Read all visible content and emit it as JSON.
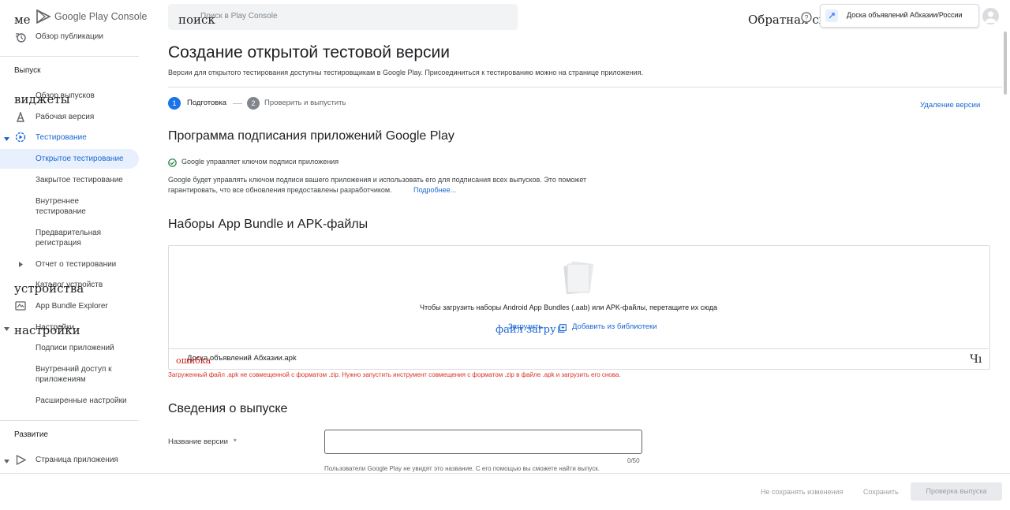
{
  "header": {
    "logo_text": "Google Play Console",
    "search_placeholder": "Поиск в Play Console",
    "search_overlay": "поиск",
    "feedback_overlay": "Обратная связь",
    "account_name": "Доска объявлений Абхазии/России",
    "menu_overlay": "ме"
  },
  "sidebar": {
    "publish_overview": "Обзор публикации",
    "release_section": "Выпуск",
    "release_overview": "Обзор выпусков",
    "widgets_overlay": "виджеты",
    "production": "Рабочая версия",
    "testing": "Тестирование",
    "open_testing": "Открытое тестирование",
    "closed_testing": "Закрытое тестирование",
    "internal_testing_1": "Внутреннее",
    "internal_testing_2": "тестирование",
    "pre_registration_1": "Предварительная",
    "pre_registration_2": "регистрация",
    "testing_report": "Отчет о тестировании",
    "device_catalog": "Каталог устройств",
    "devices_overlay": "устройства",
    "app_bundle_explorer": "App Bundle Explorer",
    "settings": "Настройки",
    "settings_overlay": "настройки",
    "app_signing": "Подписи приложений",
    "internal_sharing_1": "Внутренний доступ к",
    "internal_sharing_2": "приложениям",
    "advanced_settings": "Расширенные настройки",
    "growth_section": "Развитие",
    "store_presence": "Страница приложения"
  },
  "main": {
    "title": "Создание открытой тестовой версии",
    "subtitle": "Версии для открытого тестирования доступны тестировщикам в Google Play. Присоединиться к тестированию можно на странице приложения.",
    "step1_num": "1",
    "step1_label": "Подготовка",
    "step2_num": "2",
    "step2_label": "Проверить и выпустить",
    "discard_release": "Удаление версии",
    "signing_title": "Программа подписания приложений Google Play",
    "signing_status": "Google управляет ключом подписи приложения",
    "signing_desc_1": "Google будет управлять ключом подписи вашего приложения и использовать его для подписания всех выпусков. Это поможет",
    "signing_desc_2": "гарантировать, что все обновления предоставлены разработчиком.",
    "learn_more": "Подробнее...",
    "bundles_title": "Наборы App Bundle и APK-файлы",
    "drop_hint": "Чтобы загрузить наборы Android App Bundles (.aab) или APK-файлы, перетащите их сюда",
    "upload_label": "Загрузить",
    "upload_overlay": "файл загру",
    "add_from_library": "Добавить из библиотеки",
    "file_name": "Доска объявлений Абхазии.apk",
    "error_overlay": "ошибка",
    "file_action_overlay": "Чı",
    "error_message": "Загруженный файл .apk не совмещенной с форматом .zip. Нужно запустить инструмент совмещения с форматом .zip в файле .apk и загрузить его снова.",
    "release_details_title": "Сведения о выпуске",
    "release_name_label": "Название версии",
    "required_mark": "*",
    "release_name_value": "",
    "char_counter": "0/50",
    "release_name_hint": "Пользователи Google Play не увидят это название. С его помощью вы сможете найти выпуск."
  },
  "footer": {
    "discard_changes": "Не сохранять изменения",
    "save": "Сохранить",
    "review_release": "Проверка выпуска"
  },
  "colors": {
    "accent": "#1a73e8",
    "link": "#1967d2",
    "error": "#d93025",
    "active_bg": "#e8f0fe",
    "success": "#188038"
  }
}
